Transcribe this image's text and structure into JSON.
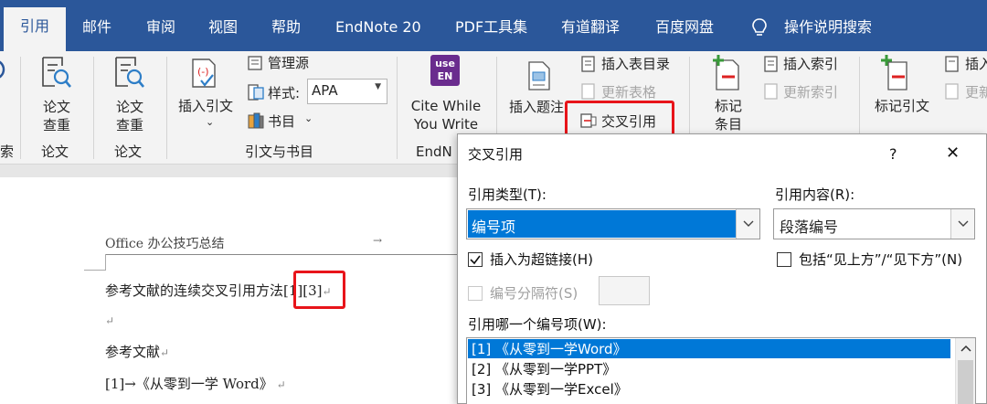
{
  "tabs": [
    "引用",
    "邮件",
    "审阅",
    "视图",
    "帮助",
    "EndNote 20",
    "PDF工具集",
    "有道翻译",
    "百度网盘",
    "操作说明搜索"
  ],
  "ribbon": {
    "partial_left_group": "索",
    "paper_check_1": "论文\n查重",
    "paper_check_2": "论文\n查重",
    "group_paper_1": "论文",
    "group_paper_2": "论文",
    "insert_citation": "插入引文",
    "manage_sources": "管理源",
    "style_label": "样式:",
    "style_value": "APA",
    "bibliography": "书目",
    "group_citations": "引文与书目",
    "endnote_icon_text": "use\nEN",
    "cite_while_you_write": "Cite While\nYou Write",
    "group_endnote": "EndN",
    "insert_caption": "插入题注",
    "insert_table_of_figures": "插入表目录",
    "update_table": "更新表格",
    "cross_reference": "交叉引用",
    "mark_entry": "标记\n条目",
    "insert_index": "插入索引",
    "update_index": "更新索引",
    "mark_citation": "标记引文",
    "insert_toa": "插入",
    "update_toa": "更新"
  },
  "document": {
    "header_text": "Office 办公技巧总结",
    "line1": "参考文献的连续交叉引用方法",
    "citation": "[1][3]",
    "heading": "参考文献",
    "ref1": "[1]→《从零到一学 Word》"
  },
  "dialog": {
    "title": "交叉引用",
    "help": "?",
    "close": "✕",
    "ref_type_label": "引用类型(T):",
    "ref_type_value": "编号项",
    "ref_content_label": "引用内容(R):",
    "ref_content_value": "段落编号",
    "insert_hyperlink": "插入为超链接(H)",
    "include_above_below": "包括“见上方”/“见下方”(N)",
    "separator_label": "编号分隔符(S)",
    "which_item_label": "引用哪一个编号项(W):",
    "items": [
      "[1] 《从零到一学Word》",
      "[2] 《从零到一学PPT》",
      "[3] 《从零到一学Excel》"
    ]
  },
  "colors": {
    "ribbon_blue": "#2b579a",
    "selection": "#0078d7",
    "highlight_red": "#e8141a"
  }
}
